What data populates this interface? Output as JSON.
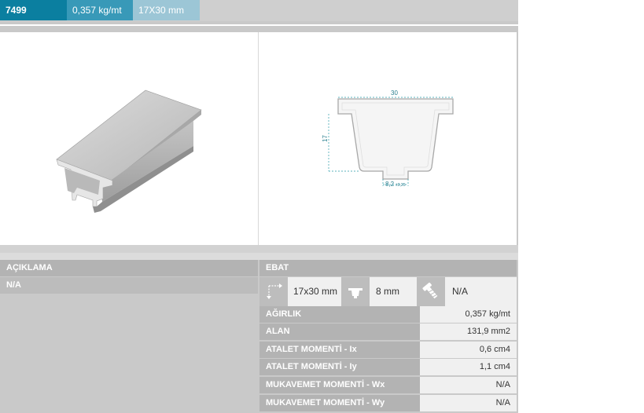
{
  "header": {
    "code": "7499",
    "weight": "0,357 kg/mt",
    "size": "17X30 mm"
  },
  "drawing": {
    "width_label": "30",
    "height_label": "17",
    "gap_label": "8,2",
    "gap_tolerance": "±0,25"
  },
  "description": {
    "title": "AÇIKLAMA",
    "value": "N/A"
  },
  "ebat": {
    "title": "EBAT",
    "dims": [
      {
        "icon": "dimension-arrows-icon",
        "value": "17x30 mm"
      },
      {
        "icon": "profile-thickness-icon",
        "value": "8 mm"
      },
      {
        "icon": "screw-icon",
        "value": "N/A"
      }
    ]
  },
  "properties": [
    {
      "label": "AĞIRLIK",
      "value": "0,357 kg/mt"
    },
    {
      "label": "ALAN",
      "value": "131,9 mm2"
    },
    {
      "label": "ATALET MOMENTİ - Ix",
      "value": "0,6 cm4"
    },
    {
      "label": "ATALET MOMENTİ - Iy",
      "value": "1,1 cm4"
    },
    {
      "label": "MUKAVEMET MOMENTİ - Wx",
      "value": "N/A"
    },
    {
      "label": "MUKAVEMET MOMENTİ - Wy",
      "value": "N/A"
    }
  ],
  "colors": {
    "accent": "#0b7fa0",
    "accent_mid": "#3899b8",
    "accent_light": "#9cc6d6",
    "dimension_line": "#2a9aa8"
  }
}
